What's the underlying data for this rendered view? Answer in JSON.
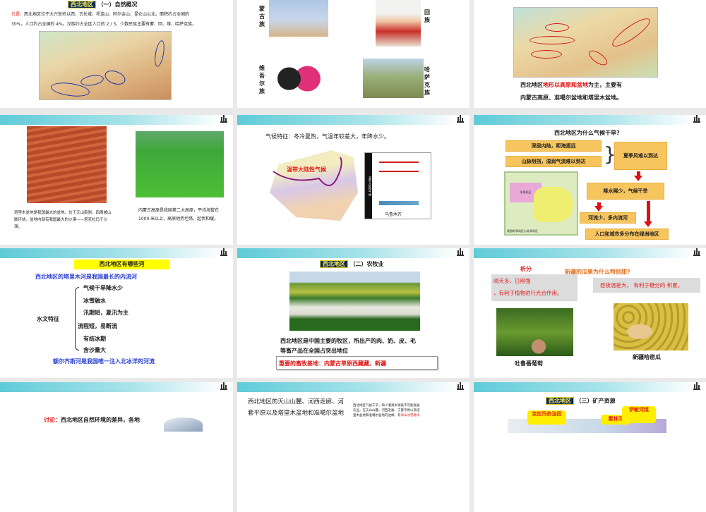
{
  "slides": {
    "s1": {
      "tag": "西北地区",
      "title": "（一）自然概况",
      "loc_label": "位置：",
      "loc_text1": "西北地区位于大兴安岭以西、古长城、祁连山、阿尔金山、昆仑山以北。面积约占全国的",
      "loc_text2": "30%，人口约占全国的 4%。汉族约占全区人口的 2 / 3，少数民族主要有蒙、回、维、哈萨克族。"
    },
    "s2": {
      "mongol": "蒙古族",
      "hui": "回族",
      "uyghur": "维吾尔族",
      "kazakh": "哈萨克族"
    },
    "s3": {
      "text_a": "西北地区",
      "text_red": "地形以高原和盆地",
      "text_b": "为主，主要有",
      "text2": "内蒙古高原、准噶尔盆地和塔里木盆地。"
    },
    "s4": {
      "cap_left": "塔里木盆地是我国最大的盆地，位于天山南侧，四周被山脉环绕，盆地内部有我国最大的沙漠——塔克拉玛干沙漠。",
      "cap_right": "内蒙古高原是我国第二大高原，平均海拔在 1000 米以上，高原地势坦荡，起伏和缓。"
    },
    "s5": {
      "text": "气候特征：冬冷夏热，气温年较差大，年降水少。",
      "map_label": "温带大陆性气候",
      "chart_city": "乌鲁木齐",
      "chart_side": "温带大陆性气候"
    },
    "s6": {
      "title": "西北地区为什么气候干旱?",
      "b1": "深居内陆，距海遥远",
      "b2": "山脉阻挡，湿润气流难以到达",
      "b3": "夏季风难以到达",
      "b4": "降水稀少，气候干旱",
      "b5": "河流少，多内流河",
      "b6": "人口和城市多分布在绿洲地区",
      "map_caption": "我国的季风区与非季风区",
      "map_region": "非季风区"
    },
    "s7": {
      "title": "西北地区有哪些河",
      "line1": "西北地区的塔里木河是我国最长的内流河",
      "label": "水文特征",
      "items": [
        "气候干旱降水少",
        "冰雪融水",
        "汛期短，夏汛为主",
        "流程短，易断流",
        "有结冰期",
        "含沙量大"
      ],
      "line2": "额尔齐斯河是我国唯一注入北冰洋的河流"
    },
    "s8": {
      "tag": "西北地区",
      "title": "（二）农牧业",
      "text1": "西北地区是中国主要的牧区，所出产的肉、奶、皮、毛",
      "text2": "等畜产品在全国占突出地位",
      "red": "重要的畜牧基地：内蒙古草原西藏藏、新疆"
    },
    "s9": {
      "analysis": "析分",
      "question": "新疆的瓜果为什么特别甜?",
      "left1": "晴天多，日照强",
      "left2": "，有利于植物进行光合作用。",
      "right": "昼夜温差大， 有利于糖分的 积累。",
      "cap1": "吐鲁番葡萄",
      "cap2": "新疆哈密瓜"
    },
    "s10": {
      "label": "讨论：",
      "text": "西北地区自然环境的差异，各地"
    },
    "s11": {
      "l1": "西北地区的天山山麓、河西走廊、河",
      "l2": "套平原以及塔里木盆地和准噶尔盆地",
      "small1": "西北地区气候干旱，缺少灌溉水源就不可能发展",
      "small2": "农业。在天山山麓、河西走廊、宁夏平原以及塔",
      "small3a": "里木盆地和准噶尔盆地的边缘，有",
      "small3red": "高山冰雪融水"
    },
    "s12": {
      "tag": "西北地区",
      "title": "（三）矿产资源",
      "b1": "克拉玛依油田",
      "b2": "霍林河",
      "b3": "伊敏河煤"
    }
  },
  "colors": {
    "band": "#5fcbd8",
    "tag_bg": "#102a5c",
    "tag_fg": "#f3e94a",
    "orange_box": "#f7c55e",
    "red": "#e01010",
    "blue": "#2a3fd0"
  }
}
